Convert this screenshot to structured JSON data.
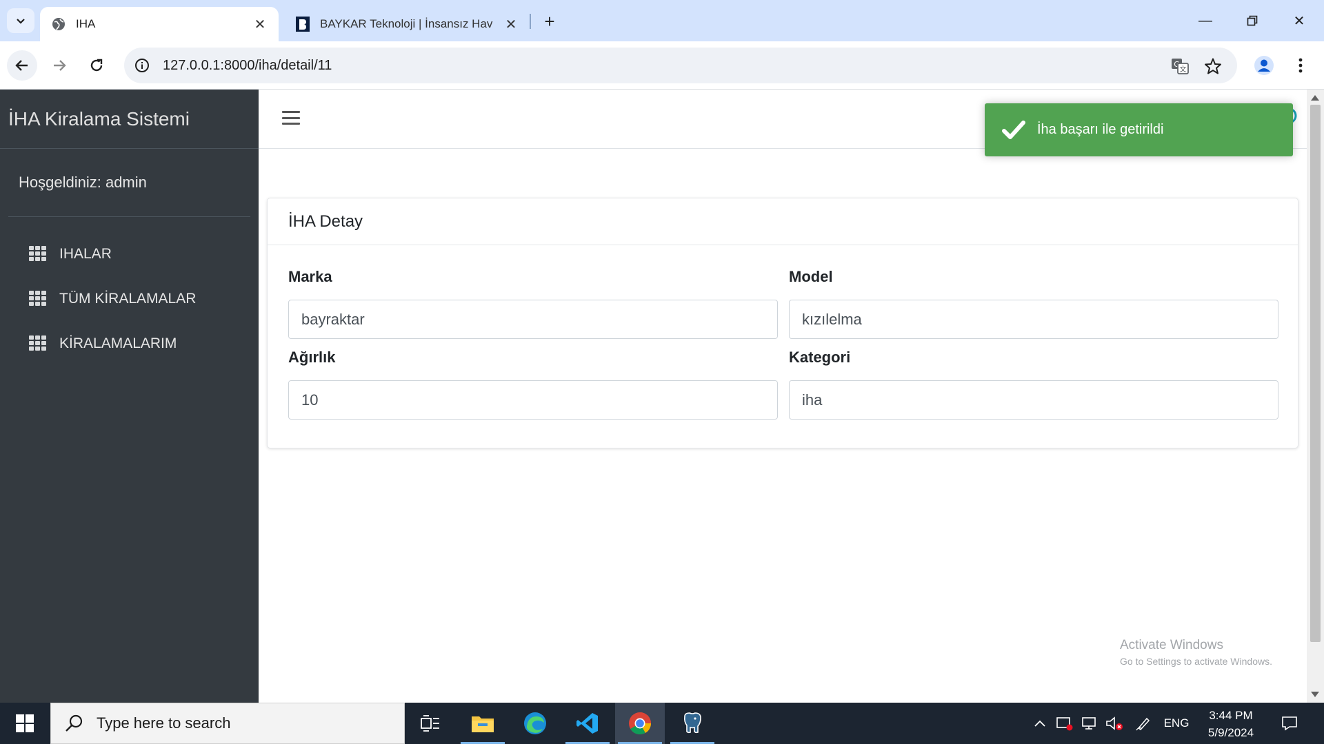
{
  "browser": {
    "tabs": [
      {
        "title": "IHA",
        "active": true
      },
      {
        "title": "BAYKAR Teknoloji | İnsansız Hav",
        "active": false
      }
    ],
    "url": "127.0.0.1:8000/iha/detail/11"
  },
  "sidebar": {
    "brand": "İHA Kiralama Sistemi",
    "welcome": "Hoşgeldiniz: admin",
    "items": [
      {
        "label": "IHALAR",
        "icon": "grid-icon"
      },
      {
        "label": "TÜM KİRALAMALAR",
        "icon": "grid-icon"
      },
      {
        "label": "KİRALAMALARIM",
        "icon": "grid-icon"
      }
    ]
  },
  "card": {
    "title": "İHA Detay",
    "fields": [
      {
        "label": "Marka",
        "value": "bayraktar"
      },
      {
        "label": "Model",
        "value": "kızılelma"
      },
      {
        "label": "Ağırlık",
        "value": "10"
      },
      {
        "label": "Kategori",
        "value": "iha"
      }
    ]
  },
  "toast": {
    "message": "İha başarı ile getirildi",
    "color": "#51a351"
  },
  "watermark": {
    "line1": "Activate Windows",
    "line2": "Go to Settings to activate Windows."
  },
  "taskbar": {
    "search_placeholder": "Type here to search",
    "language": "ENG",
    "time": "3:44 PM",
    "date": "5/9/2024"
  }
}
